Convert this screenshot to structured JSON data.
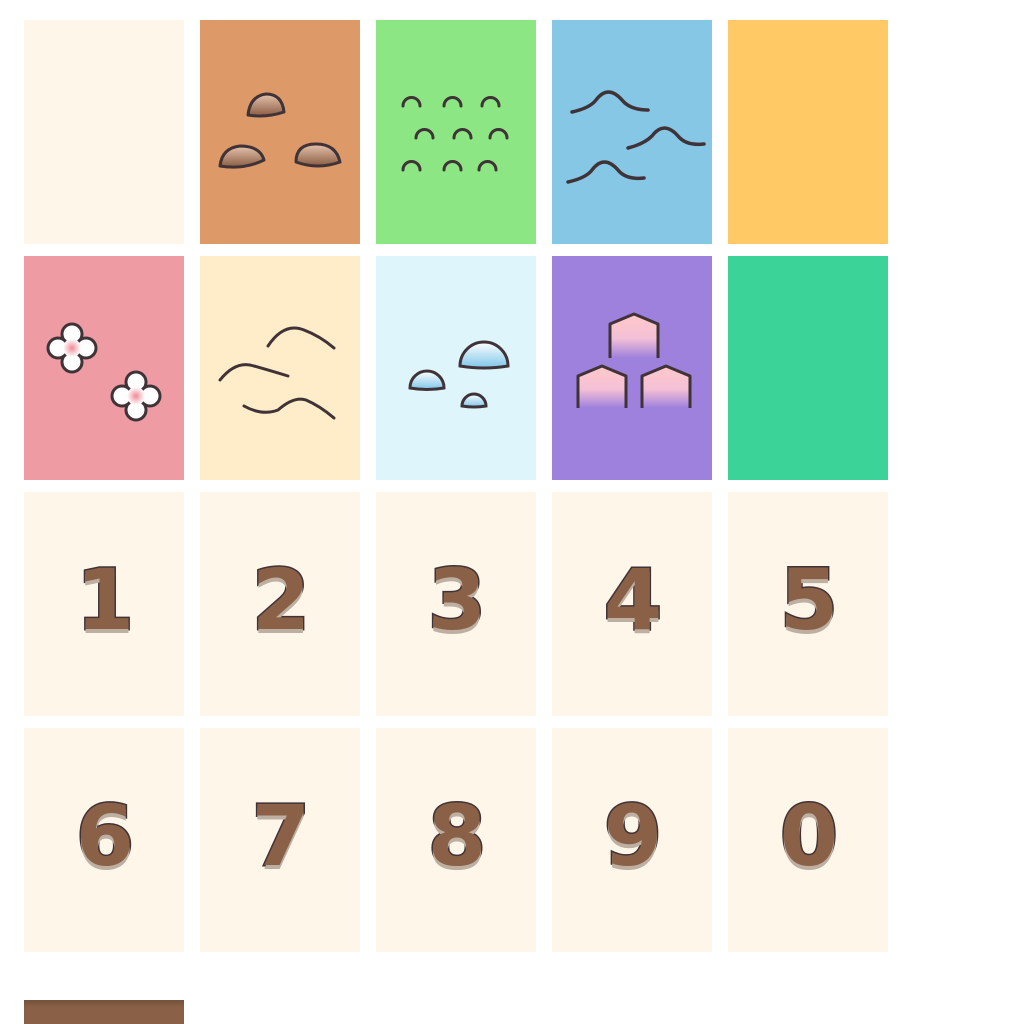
{
  "tileset": {
    "terrain_row_1": [
      {
        "type": "blank",
        "color": "#fff6ea"
      },
      {
        "type": "rocks",
        "color": "#dd9968"
      },
      {
        "type": "grass",
        "color": "#8ce683"
      },
      {
        "type": "water",
        "color": "#86c7e6"
      },
      {
        "type": "sand",
        "color": "#ffc966"
      }
    ],
    "terrain_row_2": [
      {
        "type": "flowers",
        "color": "#ee9ba4"
      },
      {
        "type": "dunes",
        "color": "#ffecc9"
      },
      {
        "type": "snow",
        "color": "#dff5fc"
      },
      {
        "type": "crystals",
        "color": "#9e80dd"
      },
      {
        "type": "jungle",
        "color": "#3cd398"
      }
    ],
    "number_tiles": [
      {
        "label": "1"
      },
      {
        "label": "2"
      },
      {
        "label": "3"
      },
      {
        "label": "4"
      },
      {
        "label": "5"
      },
      {
        "label": "6"
      },
      {
        "label": "7"
      },
      {
        "label": "8"
      },
      {
        "label": "9"
      },
      {
        "label": "0"
      }
    ],
    "number_tile_color": "#fff6ea",
    "digit_color": "#8a6146",
    "outline_color": "#3f3338",
    "partial_tile_color": "#8a6146"
  }
}
